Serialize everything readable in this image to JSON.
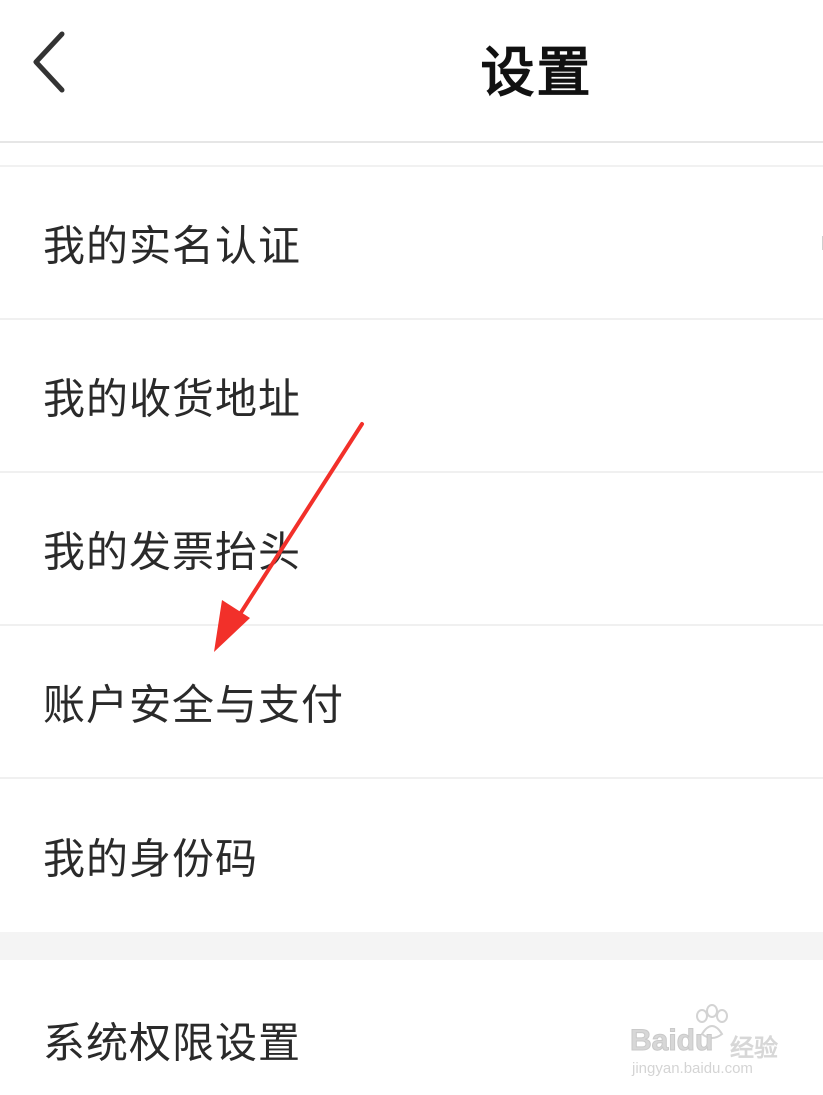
{
  "header": {
    "title": "设置",
    "back_icon": "chevron-left-icon"
  },
  "menu": {
    "items": [
      {
        "label": "我的实名认证"
      },
      {
        "label": "我的收货地址"
      },
      {
        "label": "我的发票抬头"
      },
      {
        "label": "账户安全与支付"
      },
      {
        "label": "我的身份码"
      }
    ]
  },
  "menu2": {
    "items": [
      {
        "label": "系统权限设置"
      }
    ]
  },
  "annotation": {
    "arrow_color": "#f2302a",
    "arrow_icon": "red-arrow-annotation"
  },
  "watermark": {
    "brand": "Baidu",
    "suffix": "经验",
    "url": "jingyan.baidu.com"
  }
}
